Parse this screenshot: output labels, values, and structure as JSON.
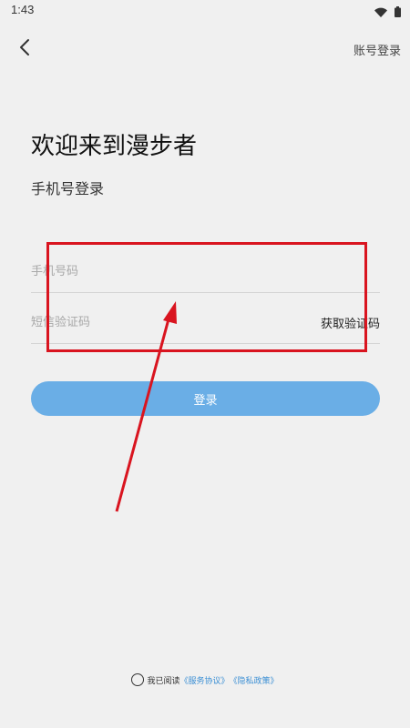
{
  "status_bar": {
    "time": "1:43",
    "icons": [
      "wifi-icon",
      "battery-icon"
    ]
  },
  "header": {
    "back_icon": "chevron-left-icon",
    "account_login_label": "账号登录"
  },
  "main": {
    "title": "欢迎来到漫步者",
    "subtitle": "手机号登录",
    "phone_field": {
      "placeholder": "手机号码",
      "value": ""
    },
    "code_field": {
      "placeholder": "短信验证码",
      "value": ""
    },
    "get_code_label": "获取验证码",
    "login_label": "登录"
  },
  "agreement": {
    "prefix": "我已阅读",
    "service_link": "《服务协议》",
    "privacy_link": "《隐私政策》"
  },
  "colors": {
    "background": "#f0f0f0",
    "login_button": "#6aaee6",
    "link": "#3b8fd4",
    "annotation": "#d9141f"
  }
}
